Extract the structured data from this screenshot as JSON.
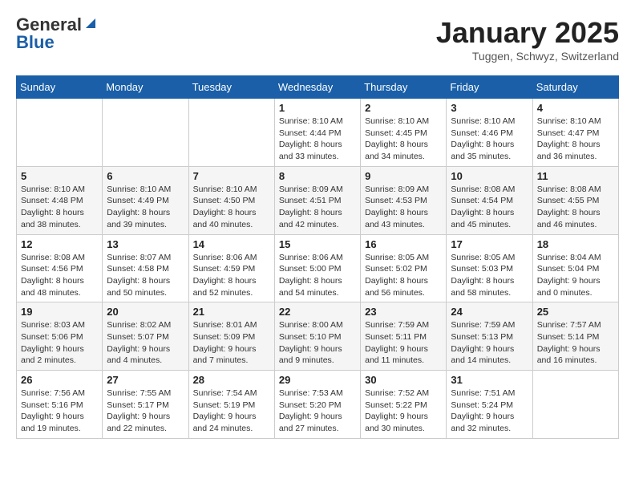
{
  "header": {
    "logo_general": "General",
    "logo_blue": "Blue",
    "month": "January 2025",
    "location": "Tuggen, Schwyz, Switzerland"
  },
  "weekdays": [
    "Sunday",
    "Monday",
    "Tuesday",
    "Wednesday",
    "Thursday",
    "Friday",
    "Saturday"
  ],
  "weeks": [
    [
      {
        "day": "",
        "info": ""
      },
      {
        "day": "",
        "info": ""
      },
      {
        "day": "",
        "info": ""
      },
      {
        "day": "1",
        "info": "Sunrise: 8:10 AM\nSunset: 4:44 PM\nDaylight: 8 hours\nand 33 minutes."
      },
      {
        "day": "2",
        "info": "Sunrise: 8:10 AM\nSunset: 4:45 PM\nDaylight: 8 hours\nand 34 minutes."
      },
      {
        "day": "3",
        "info": "Sunrise: 8:10 AM\nSunset: 4:46 PM\nDaylight: 8 hours\nand 35 minutes."
      },
      {
        "day": "4",
        "info": "Sunrise: 8:10 AM\nSunset: 4:47 PM\nDaylight: 8 hours\nand 36 minutes."
      }
    ],
    [
      {
        "day": "5",
        "info": "Sunrise: 8:10 AM\nSunset: 4:48 PM\nDaylight: 8 hours\nand 38 minutes."
      },
      {
        "day": "6",
        "info": "Sunrise: 8:10 AM\nSunset: 4:49 PM\nDaylight: 8 hours\nand 39 minutes."
      },
      {
        "day": "7",
        "info": "Sunrise: 8:10 AM\nSunset: 4:50 PM\nDaylight: 8 hours\nand 40 minutes."
      },
      {
        "day": "8",
        "info": "Sunrise: 8:09 AM\nSunset: 4:51 PM\nDaylight: 8 hours\nand 42 minutes."
      },
      {
        "day": "9",
        "info": "Sunrise: 8:09 AM\nSunset: 4:53 PM\nDaylight: 8 hours\nand 43 minutes."
      },
      {
        "day": "10",
        "info": "Sunrise: 8:08 AM\nSunset: 4:54 PM\nDaylight: 8 hours\nand 45 minutes."
      },
      {
        "day": "11",
        "info": "Sunrise: 8:08 AM\nSunset: 4:55 PM\nDaylight: 8 hours\nand 46 minutes."
      }
    ],
    [
      {
        "day": "12",
        "info": "Sunrise: 8:08 AM\nSunset: 4:56 PM\nDaylight: 8 hours\nand 48 minutes."
      },
      {
        "day": "13",
        "info": "Sunrise: 8:07 AM\nSunset: 4:58 PM\nDaylight: 8 hours\nand 50 minutes."
      },
      {
        "day": "14",
        "info": "Sunrise: 8:06 AM\nSunset: 4:59 PM\nDaylight: 8 hours\nand 52 minutes."
      },
      {
        "day": "15",
        "info": "Sunrise: 8:06 AM\nSunset: 5:00 PM\nDaylight: 8 hours\nand 54 minutes."
      },
      {
        "day": "16",
        "info": "Sunrise: 8:05 AM\nSunset: 5:02 PM\nDaylight: 8 hours\nand 56 minutes."
      },
      {
        "day": "17",
        "info": "Sunrise: 8:05 AM\nSunset: 5:03 PM\nDaylight: 8 hours\nand 58 minutes."
      },
      {
        "day": "18",
        "info": "Sunrise: 8:04 AM\nSunset: 5:04 PM\nDaylight: 9 hours\nand 0 minutes."
      }
    ],
    [
      {
        "day": "19",
        "info": "Sunrise: 8:03 AM\nSunset: 5:06 PM\nDaylight: 9 hours\nand 2 minutes."
      },
      {
        "day": "20",
        "info": "Sunrise: 8:02 AM\nSunset: 5:07 PM\nDaylight: 9 hours\nand 4 minutes."
      },
      {
        "day": "21",
        "info": "Sunrise: 8:01 AM\nSunset: 5:09 PM\nDaylight: 9 hours\nand 7 minutes."
      },
      {
        "day": "22",
        "info": "Sunrise: 8:00 AM\nSunset: 5:10 PM\nDaylight: 9 hours\nand 9 minutes."
      },
      {
        "day": "23",
        "info": "Sunrise: 7:59 AM\nSunset: 5:11 PM\nDaylight: 9 hours\nand 11 minutes."
      },
      {
        "day": "24",
        "info": "Sunrise: 7:59 AM\nSunset: 5:13 PM\nDaylight: 9 hours\nand 14 minutes."
      },
      {
        "day": "25",
        "info": "Sunrise: 7:57 AM\nSunset: 5:14 PM\nDaylight: 9 hours\nand 16 minutes."
      }
    ],
    [
      {
        "day": "26",
        "info": "Sunrise: 7:56 AM\nSunset: 5:16 PM\nDaylight: 9 hours\nand 19 minutes."
      },
      {
        "day": "27",
        "info": "Sunrise: 7:55 AM\nSunset: 5:17 PM\nDaylight: 9 hours\nand 22 minutes."
      },
      {
        "day": "28",
        "info": "Sunrise: 7:54 AM\nSunset: 5:19 PM\nDaylight: 9 hours\nand 24 minutes."
      },
      {
        "day": "29",
        "info": "Sunrise: 7:53 AM\nSunset: 5:20 PM\nDaylight: 9 hours\nand 27 minutes."
      },
      {
        "day": "30",
        "info": "Sunrise: 7:52 AM\nSunset: 5:22 PM\nDaylight: 9 hours\nand 30 minutes."
      },
      {
        "day": "31",
        "info": "Sunrise: 7:51 AM\nSunset: 5:24 PM\nDaylight: 9 hours\nand 32 minutes."
      },
      {
        "day": "",
        "info": ""
      }
    ]
  ]
}
